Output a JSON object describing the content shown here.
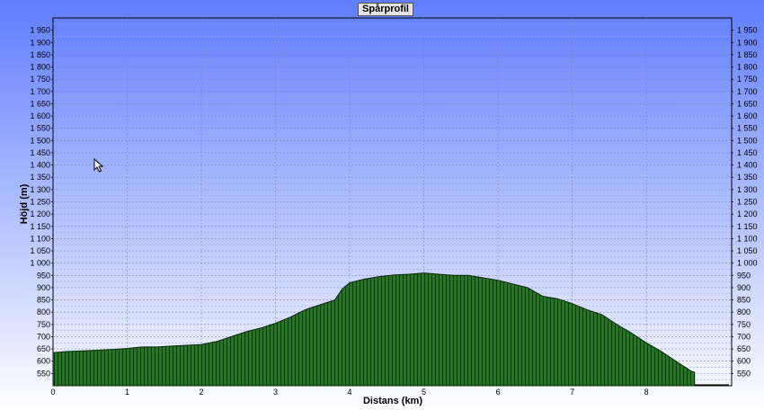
{
  "chart_data": {
    "type": "area",
    "title": "Spårprofil",
    "xlabel": "Distans (km)",
    "ylabel": "Höjd (m)",
    "xlim": [
      0,
      9.15
    ],
    "ylim": [
      500,
      2000
    ],
    "grid": true,
    "fill_color": "#1f7a1f",
    "x_ticks": [
      "0",
      "1",
      "2",
      "3",
      "4",
      "5",
      "6",
      "7",
      "8"
    ],
    "y_ticks": [
      "550",
      "600",
      "650",
      "700",
      "750",
      "800",
      "850",
      "900",
      "950",
      "1 000",
      "1 050",
      "1 100",
      "1 150",
      "1 200",
      "1 250",
      "1 300",
      "1 350",
      "1 400",
      "1 450",
      "1 500",
      "1 550",
      "1 600",
      "1 650",
      "1 700",
      "1 750",
      "1 800",
      "1 850",
      "1 900",
      "1 950"
    ],
    "series": [
      {
        "x": [
          0,
          0.2,
          0.4,
          0.6,
          0.8,
          1.0,
          1.2,
          1.4,
          1.6,
          1.8,
          2.0,
          2.2,
          2.4,
          2.6,
          2.8,
          3.0,
          3.2,
          3.4,
          3.6,
          3.8,
          3.9,
          4.0,
          4.2,
          4.4,
          4.6,
          4.8,
          5.0,
          5.2,
          5.4,
          5.6,
          5.8,
          6.0,
          6.2,
          6.4,
          6.6,
          6.8,
          7.0,
          7.2,
          7.4,
          7.6,
          7.8,
          8.0,
          8.2,
          8.4,
          8.6,
          8.65
        ],
        "y": [
          635,
          640,
          642,
          645,
          648,
          652,
          658,
          658,
          662,
          665,
          668,
          680,
          700,
          720,
          735,
          755,
          780,
          810,
          830,
          850,
          895,
          920,
          935,
          945,
          952,
          955,
          960,
          955,
          950,
          950,
          940,
          930,
          915,
          900,
          865,
          855,
          835,
          810,
          790,
          750,
          715,
          675,
          640,
          600,
          560,
          555
        ]
      }
    ]
  }
}
